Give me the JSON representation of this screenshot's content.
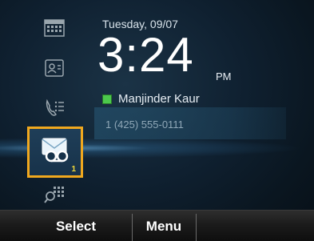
{
  "home": {
    "date": "Tuesday, 09/07",
    "time": "3:24",
    "ampm": "PM",
    "line": {
      "user_name": "Manjinder Kaur",
      "phone_number": "1 (425) 555-0111",
      "presence_color": "#4cc94c"
    }
  },
  "rail": {
    "items": [
      {
        "icon": "calendar-icon"
      },
      {
        "icon": "contacts-icon"
      },
      {
        "icon": "recents-icon"
      },
      {
        "icon": "voicemail-icon",
        "badge": "1",
        "selected": true
      },
      {
        "icon": "dialpad-icon"
      }
    ],
    "highlight_color": "#f0a81e"
  },
  "softkeys": {
    "select": "Select",
    "menu": "Menu"
  }
}
